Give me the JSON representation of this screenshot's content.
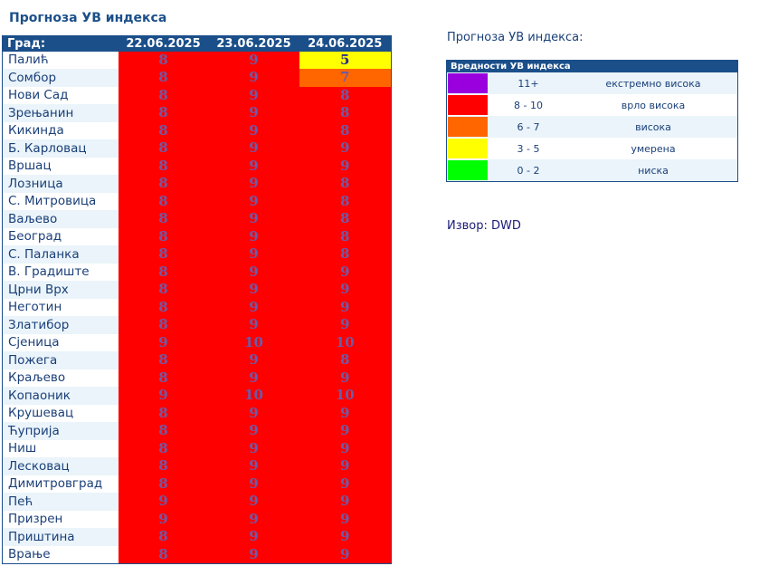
{
  "title": "Прогноза УВ индекса",
  "table": {
    "header_city": "Град:",
    "dates": [
      "22.06.2025",
      "23.06.2025",
      "24.06.2025"
    ],
    "rows": [
      {
        "city": "Палић",
        "values": [
          "8",
          "9",
          "5"
        ]
      },
      {
        "city": "Сомбор",
        "values": [
          "8",
          "9",
          "7"
        ]
      },
      {
        "city": "Нови Сад",
        "values": [
          "8",
          "9",
          "8"
        ]
      },
      {
        "city": "Зрењанин",
        "values": [
          "8",
          "9",
          "8"
        ]
      },
      {
        "city": "Кикинда",
        "values": [
          "8",
          "9",
          "8"
        ]
      },
      {
        "city": "Б. Карловац",
        "values": [
          "8",
          "9",
          "9"
        ]
      },
      {
        "city": "Вршац",
        "values": [
          "8",
          "9",
          "9"
        ]
      },
      {
        "city": "Лозница",
        "values": [
          "8",
          "9",
          "8"
        ]
      },
      {
        "city": "С. Митровица",
        "values": [
          "8",
          "9",
          "8"
        ]
      },
      {
        "city": "Ваљево",
        "values": [
          "8",
          "9",
          "8"
        ]
      },
      {
        "city": "Београд",
        "values": [
          "8",
          "9",
          "8"
        ]
      },
      {
        "city": "С. Паланка",
        "values": [
          "8",
          "9",
          "8"
        ]
      },
      {
        "city": "В. Градиште",
        "values": [
          "8",
          "9",
          "9"
        ]
      },
      {
        "city": "Црни Врх",
        "values": [
          "8",
          "9",
          "9"
        ]
      },
      {
        "city": "Неготин",
        "values": [
          "8",
          "9",
          "9"
        ]
      },
      {
        "city": "Златибор",
        "values": [
          "8",
          "9",
          "9"
        ]
      },
      {
        "city": "Сјеница",
        "values": [
          "9",
          "10",
          "10"
        ]
      },
      {
        "city": "Пожега",
        "values": [
          "8",
          "9",
          "8"
        ]
      },
      {
        "city": "Краљево",
        "values": [
          "8",
          "9",
          "9"
        ]
      },
      {
        "city": "Копаоник",
        "values": [
          "9",
          "10",
          "10"
        ]
      },
      {
        "city": "Крушевац",
        "values": [
          "8",
          "9",
          "9"
        ]
      },
      {
        "city": "Ћуприја",
        "values": [
          "8",
          "9",
          "9"
        ]
      },
      {
        "city": "Ниш",
        "values": [
          "8",
          "9",
          "9"
        ]
      },
      {
        "city": "Лесковац",
        "values": [
          "8",
          "9",
          "9"
        ]
      },
      {
        "city": "Димитровград",
        "values": [
          "8",
          "9",
          "9"
        ]
      },
      {
        "city": "Пећ",
        "values": [
          "9",
          "9",
          "9"
        ]
      },
      {
        "city": "Призрен",
        "values": [
          "9",
          "9",
          "9"
        ]
      },
      {
        "city": "Приштина",
        "values": [
          "8",
          "9",
          "9"
        ]
      },
      {
        "city": "Врање",
        "values": [
          "8",
          "9",
          "9"
        ]
      }
    ]
  },
  "legend": {
    "title": "Прогноза УВ индекса:",
    "header": "Вредности УВ индекса",
    "levels": [
      {
        "range": "11+",
        "label": "екстремно висока",
        "color": "#9900dd",
        "text_color": "#7b3fb0"
      },
      {
        "range": "8 - 10",
        "label": "врло висока",
        "color": "#ff0000",
        "text_color": "#6b5ba8"
      },
      {
        "range": "6 - 7",
        "label": "висока",
        "color": "#ff6600",
        "text_color": "#6b5ba8"
      },
      {
        "range": "3 - 5",
        "label": "умерена",
        "color": "#ffff00",
        "text_color": "#2b2b8a"
      },
      {
        "range": "0 - 2",
        "label": "ниска",
        "color": "#00ff00",
        "text_color": "#2b2b8a"
      }
    ]
  },
  "source": "Извор: DWD"
}
